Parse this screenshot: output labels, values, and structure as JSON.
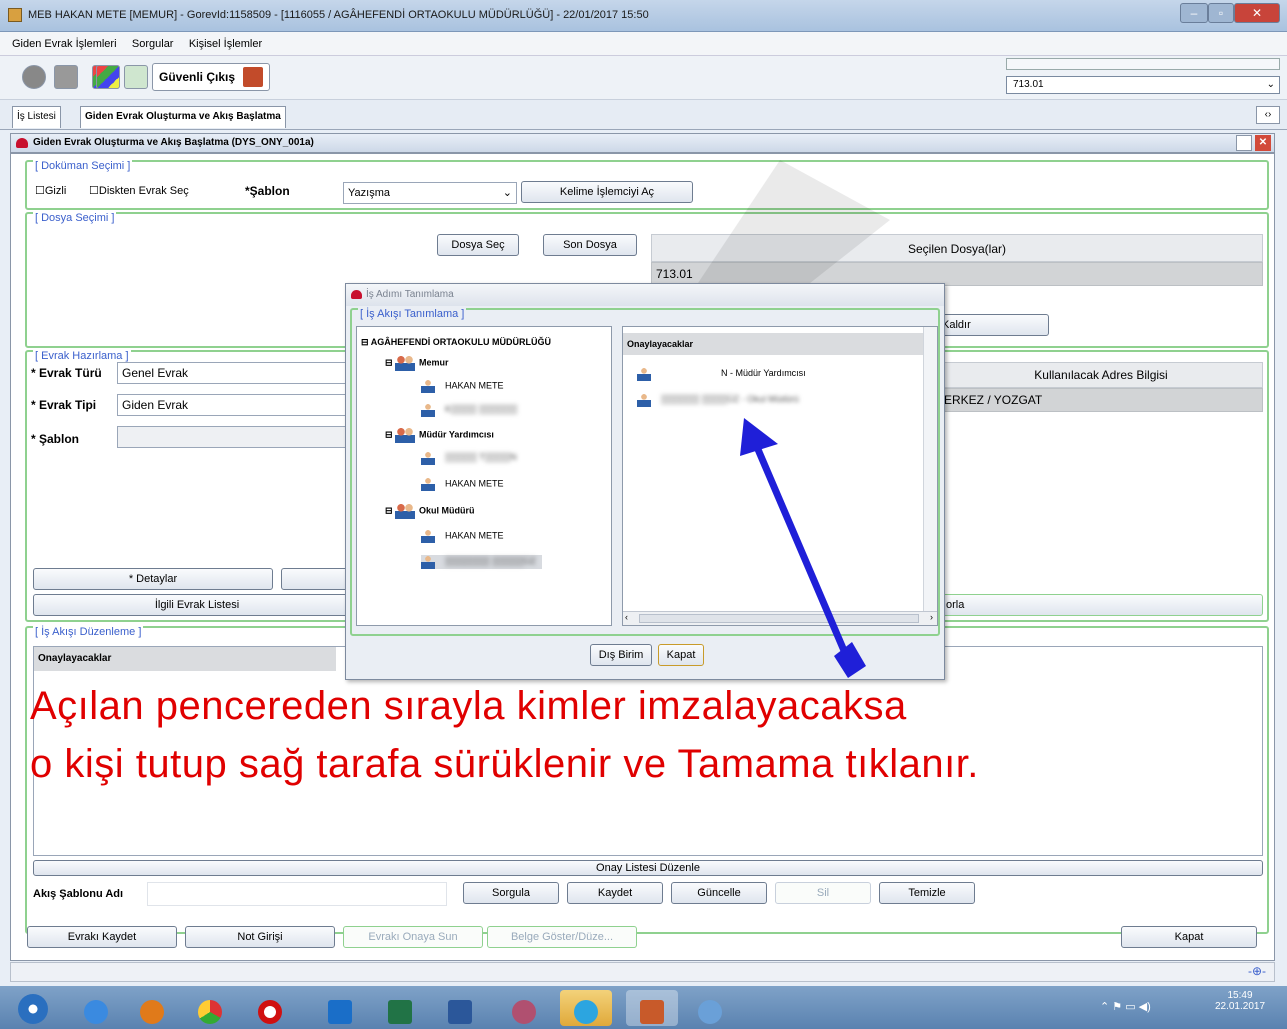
{
  "window": {
    "title": "MEB  HAKAN METE  [MEMUR] - GorevId:1158509 - [1116055 / AGÂHEFENDİ ORTAOKULU MÜDÜRLÜĞÜ] - 22/01/2017 15:50"
  },
  "menu": {
    "items": [
      "Giden Evrak İşlemleri",
      "Sorgular",
      "Kişisel İşlemler"
    ]
  },
  "toolbar": {
    "secure_exit_label": "Güvenli Çıkış",
    "combo_value": "713.01"
  },
  "tabs": [
    "İş Listesi",
    "Giden Evrak Oluşturma ve Akış Başlatma"
  ],
  "inner_window": {
    "title": "Giden Evrak Oluşturma ve Akış Başlatma (DYS_ONY_001a)"
  },
  "doc_select": {
    "title": "[ Doküman Seçimi ]",
    "gizli": "Gizli",
    "disk": "Diskten Evrak Seç",
    "sablon_label": "*Şablon",
    "sablon_value": "Yazışma",
    "word_button": "Kelime İşlemciyi Aç"
  },
  "file_select": {
    "title": "[ Dosya Seçimi ]",
    "choose_button": "Dosya Seç",
    "last_button": "Son Dosya",
    "selected_header": "Seçilen Dosya(lar)",
    "selected_value": "713.01",
    "remove_button": "Kaldır"
  },
  "evrak_prep": {
    "title": "[ Evrak Hazırlama ]",
    "tur_label": "* Evrak Türü",
    "tur_value": "Genel Evrak",
    "tip_label": "* Evrak Tipi",
    "tip_value": "Giden Evrak",
    "sablon_label": "* Şablon",
    "address_header": "Kullanılacak Adres Bilgisi",
    "address_value": "ERKEZ / YOZGAT",
    "details_button": "* Detaylar",
    "related_button": "İlgili Evrak Listesi",
    "partial_button": "orla"
  },
  "workflow": {
    "title": "[ İş Akışı Düzenleme ]",
    "approvers_header": "Onaylayacaklar",
    "edit_list_button": "Onay Listesi Düzenle",
    "template_label": "Akış Şablonu Adı",
    "query_button": "Sorgula",
    "save_button": "Kaydet",
    "update_button": "Güncelle",
    "delete_button": "Sil",
    "clear_button": "Temizle"
  },
  "bottom_buttons": {
    "save_doc": "Evrakı Kaydet",
    "note": "Not Girişi",
    "submit": "Evrakı Onaya Sun",
    "show_doc": "Belge Göster/Düze...",
    "close": "Kapat"
  },
  "dialog": {
    "title": "İş Adımı Tanımlama",
    "group_title": "[ İş Akışı Tanımlama ]",
    "root": "AGÂHEFENDİ ORTAOKULU MÜDÜRLÜĞÜ",
    "groups": [
      {
        "name": "Memur",
        "people": [
          "HAKAN METE",
          "K▒▒▒▒ ▒▒▒▒▒▒"
        ]
      },
      {
        "name": "Müdür Yardımcısı",
        "people": [
          "▒▒▒▒▒ T▒▒▒▒N",
          "HAKAN METE"
        ]
      },
      {
        "name": "Okul Müdürü",
        "people": [
          "HAKAN METE",
          "▒▒▒▒▒▒▒ ▒▒▒▒▒ÜZ"
        ]
      }
    ],
    "approvers_header": "Onaylayacaklar",
    "approvers": [
      "N - Müdür Yardımcısı",
      "▒▒▒▒▒▒ ▒▒▒▒ÜZ - Okul Müdürü"
    ],
    "external_button": "Dış Birim",
    "close_button": "Kapat"
  },
  "annotation": {
    "line1": "Açılan pencereden sırayla kimler imzalayacaksa",
    "line2": "o kişi tutup sağ tarafa sürüklenir ve Tamama tıklanır."
  },
  "taskbar": {
    "time": "15:49",
    "date": "22.01.2017"
  },
  "colors": {
    "annotation_red": "#e00000",
    "arrow_blue": "#1f1fd8",
    "group_border": "#8fd18f"
  }
}
